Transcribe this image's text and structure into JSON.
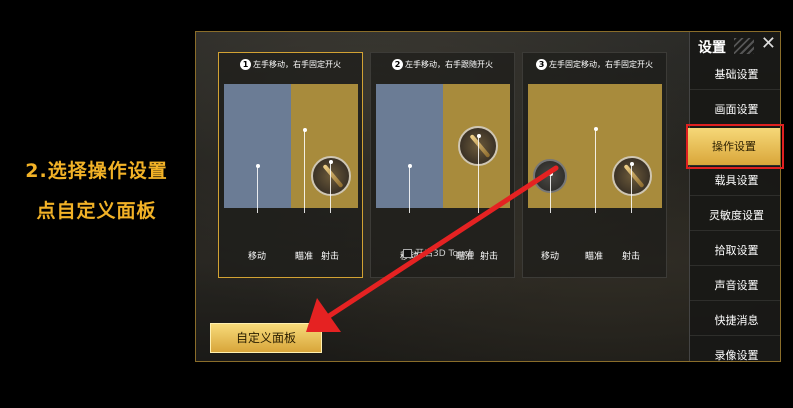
{
  "instruction": {
    "line1": "2.选择操作设置",
    "line2": "点自定义面板"
  },
  "cards": [
    {
      "number": "1",
      "title": "左手移动，右手固定开火",
      "labels": [
        "移动",
        "瞄准",
        "射击"
      ]
    },
    {
      "number": "2",
      "title": "左手移动，右手跟随开火",
      "labels": [
        "移动",
        "瞄准",
        "射击"
      ],
      "touch_option": "开启3D Touch"
    },
    {
      "number": "3",
      "title": "左手固定移动，右手固定开火",
      "labels": [
        "移动",
        "瞄准",
        "射击"
      ]
    }
  ],
  "custom_panel_button": "自定义面板",
  "sidebar": {
    "title": "设置",
    "close": "✕",
    "items": [
      "基础设置",
      "画面设置",
      "操作设置",
      "载具设置",
      "灵敏度设置",
      "拾取设置",
      "声音设置",
      "快捷消息",
      "录像设置"
    ],
    "active_index": 2
  },
  "colors": {
    "accent_gold": "#f2b227",
    "highlight_red": "#e02020",
    "zone_blue": "#6b7c95",
    "zone_gold": "#a88b3c"
  },
  "icons": {
    "fire_button": "bullet-fire-icon",
    "joystick": "joystick-icon",
    "close": "close-icon",
    "arrow": "red-arrow"
  }
}
